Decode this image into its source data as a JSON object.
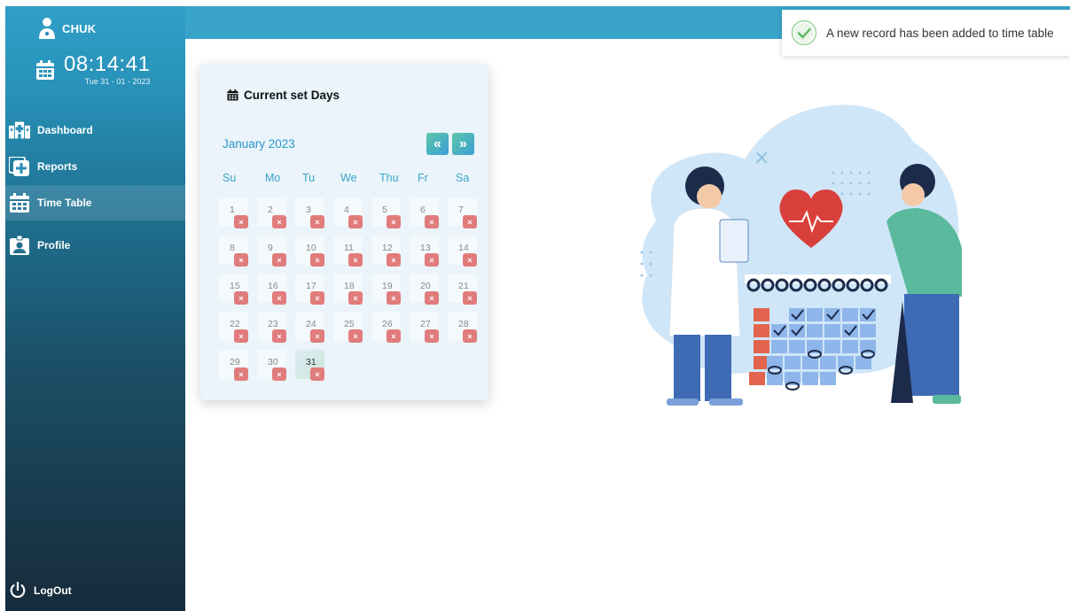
{
  "brand": {
    "name": "CHUK",
    "icon": "doctor-icon"
  },
  "clock": {
    "time": "08:14:41",
    "date": "Tue 31 - 01 - 2023",
    "icon": "calendar-icon"
  },
  "nav": [
    {
      "label": "Dashboard",
      "icon": "hospital-icon"
    },
    {
      "label": "Reports",
      "icon": "medical-file-icon"
    },
    {
      "label": "Time Table",
      "icon": "calendar-grid-icon"
    },
    {
      "label": "Profile",
      "icon": "id-badge-icon"
    }
  ],
  "logout": {
    "label": "LogOut",
    "icon": "power-icon"
  },
  "toast": {
    "message": "A new record has been added to time table",
    "icon": "check-circle-icon"
  },
  "calendar": {
    "title": "Current set Days",
    "month": "January 2023",
    "prev_label": "«",
    "next_label": "»",
    "weekdays": [
      "Su",
      "Mo",
      "Tu",
      "We",
      "Thu",
      "Fr",
      "Sa"
    ],
    "days": [
      "1",
      "2",
      "3",
      "4",
      "5",
      "6",
      "7",
      "8",
      "9",
      "10",
      "11",
      "12",
      "13",
      "14",
      "15",
      "16",
      "17",
      "18",
      "19",
      "20",
      "21",
      "22",
      "23",
      "24",
      "25",
      "26",
      "27",
      "28",
      "29",
      "30",
      "31"
    ],
    "today": "31",
    "remove_label": "×"
  },
  "colors": {
    "accent": "#3aa3ca",
    "remove": "#e17c7c",
    "sidebar_top": "#2f9fc9",
    "sidebar_bottom": "#172b3b"
  }
}
